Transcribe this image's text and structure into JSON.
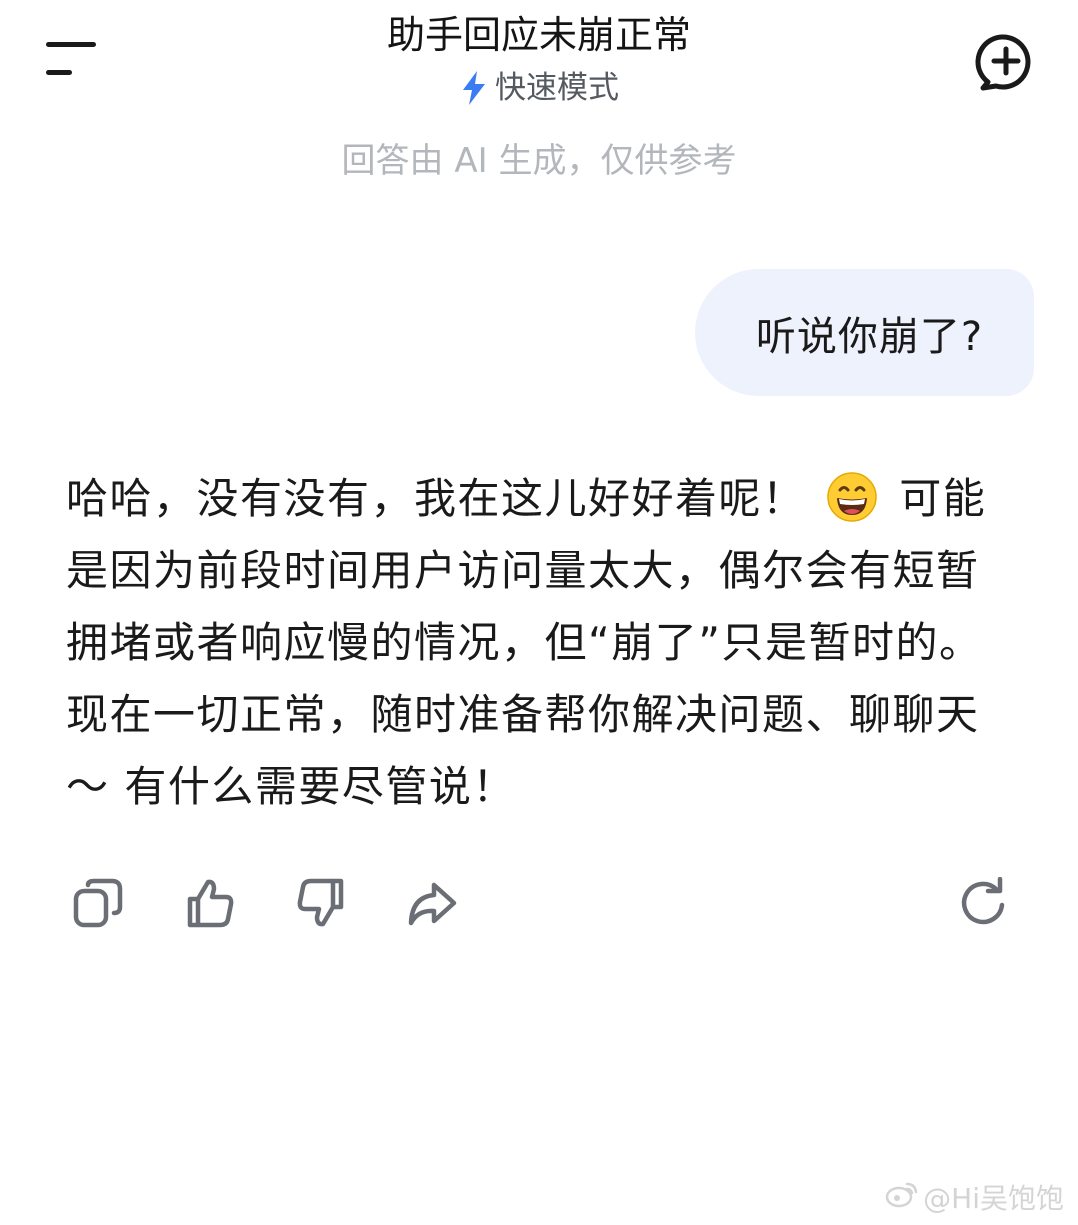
{
  "header": {
    "title": "助手回应未崩正常",
    "mode_label": "快速模式",
    "icons": {
      "menu": "menu-icon",
      "mode": "lightning-icon",
      "new_chat": "new-chat-icon"
    },
    "colors": {
      "mode_icon": "#3b7cf5"
    }
  },
  "disclaimer": "回答由 AI 生成，仅供参考",
  "conversation": {
    "user_message": "听说你崩了?",
    "assistant_message": {
      "part1": "哈哈，没有没有，我在这儿好好着呢！",
      "emoji": "grinning-face",
      "part2": " 可能是因为前段时间用户访问量太大，偶尔会有短暂拥堵或者响应慢的情况，但“崩了”只是暂时的。现在一切正常，随时准备帮你解决问题、聊聊天～ 有什么需要尽管说！"
    }
  },
  "actions": [
    {
      "icon": "copy-icon"
    },
    {
      "icon": "thumbs-up-icon"
    },
    {
      "icon": "thumbs-down-icon"
    },
    {
      "icon": "share-icon"
    },
    {
      "icon": "regenerate-icon"
    }
  ],
  "watermark": {
    "text": "@Hi吴饱饱",
    "icon": "weibo-logo"
  },
  "colors": {
    "background": "#ffffff",
    "user_bubble": "#eef2fc",
    "text": "#1a1a1a",
    "muted_text": "#b3b6bb",
    "icon_gray": "#6b6f75"
  }
}
